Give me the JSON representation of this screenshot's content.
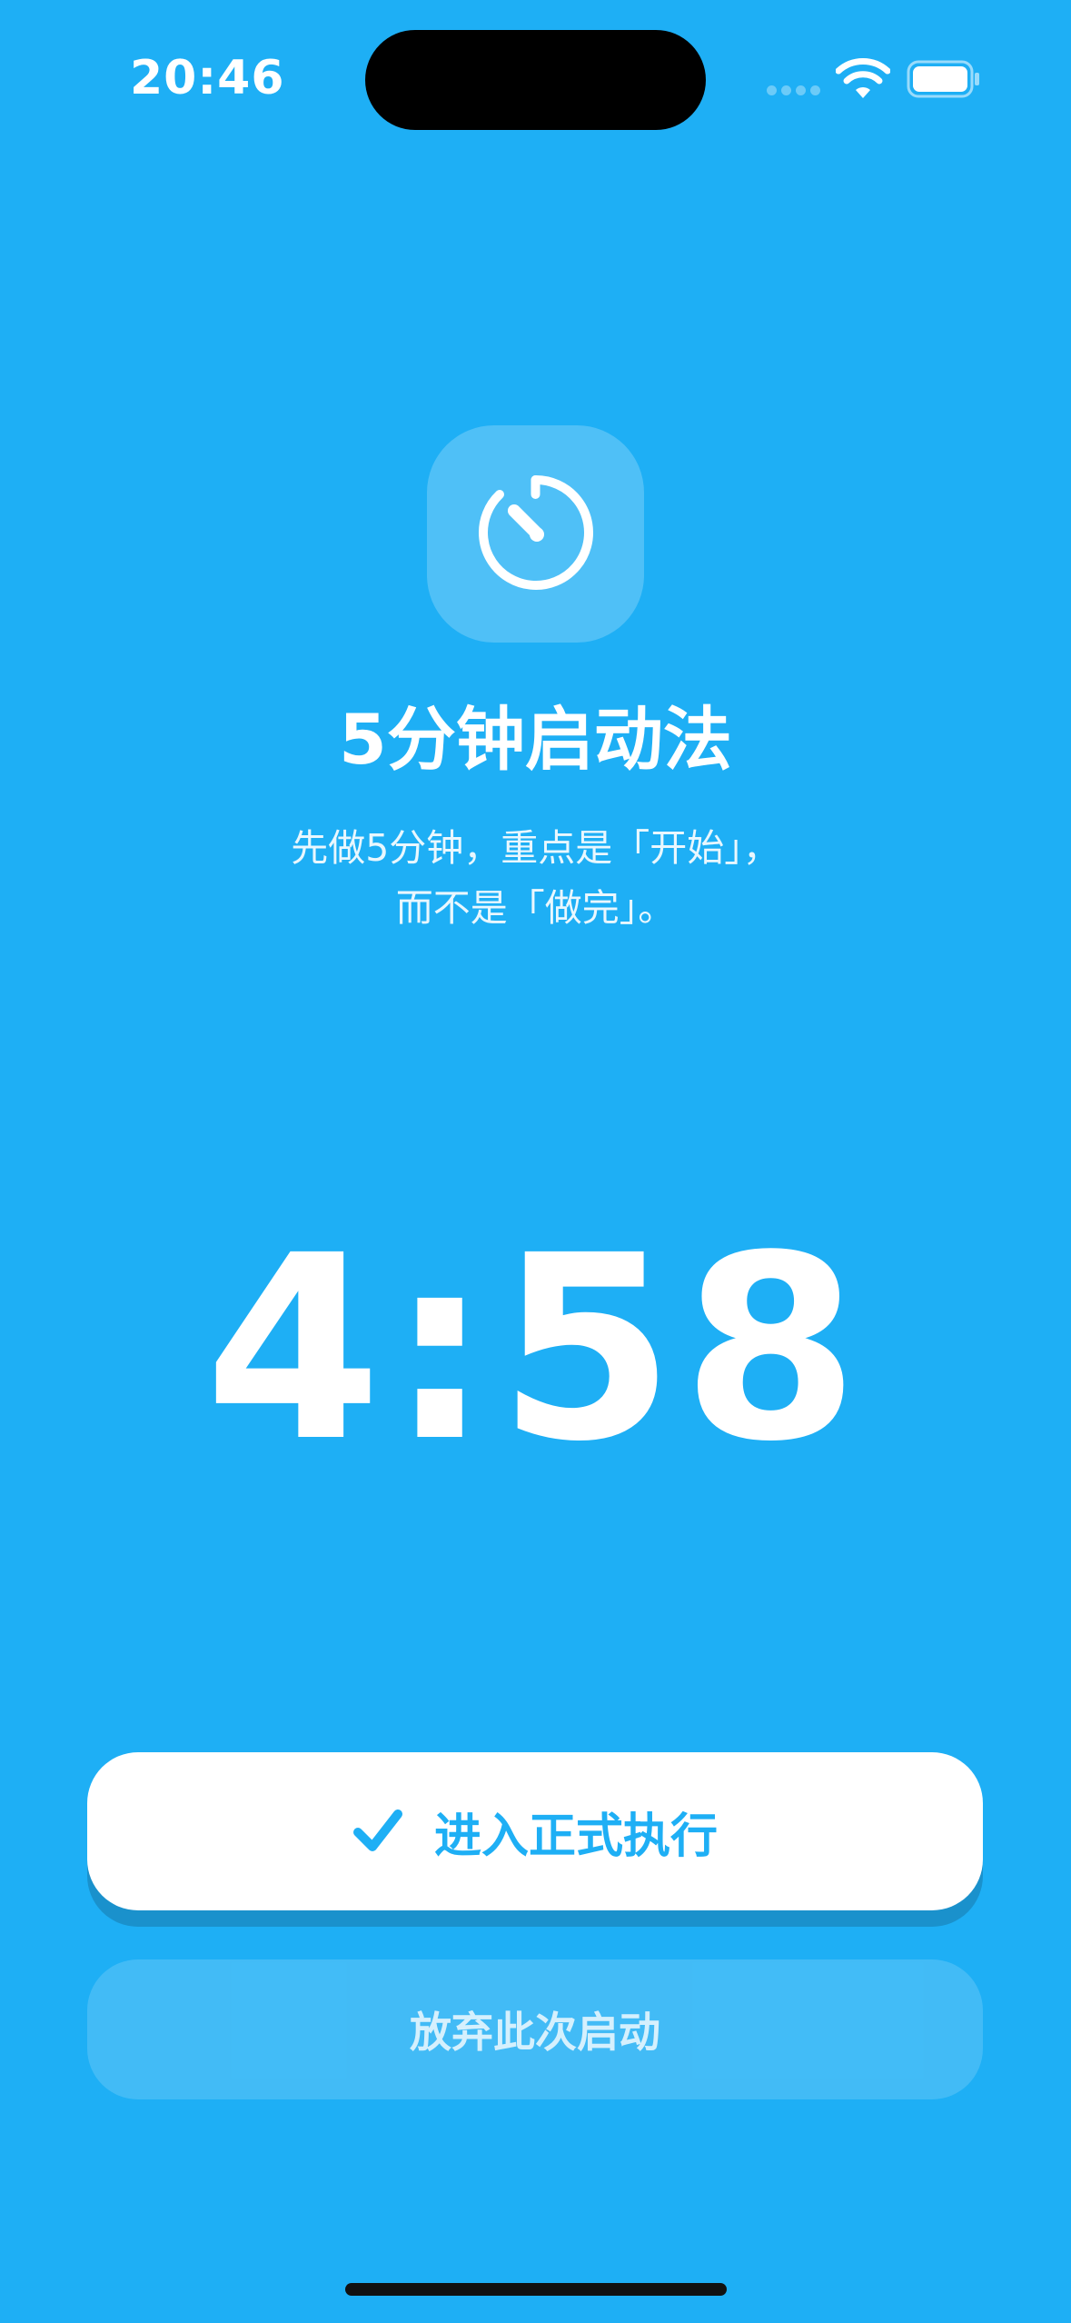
{
  "status_bar": {
    "time": "20:46"
  },
  "header": {
    "icon": "stopwatch-icon",
    "title": "5分钟启动法",
    "subtitle_line1": "先做5分钟，重点是「开始」，",
    "subtitle_line2": "而不是「做完」。"
  },
  "timer": {
    "display": "4:58"
  },
  "actions": {
    "primary_label": "进入正式执行",
    "primary_icon": "checkmark-icon",
    "secondary_label": "放弃此次启动"
  },
  "colors": {
    "background": "#1eaff5",
    "primary_button_bg": "#ffffff",
    "primary_button_text": "#1eaff5"
  }
}
